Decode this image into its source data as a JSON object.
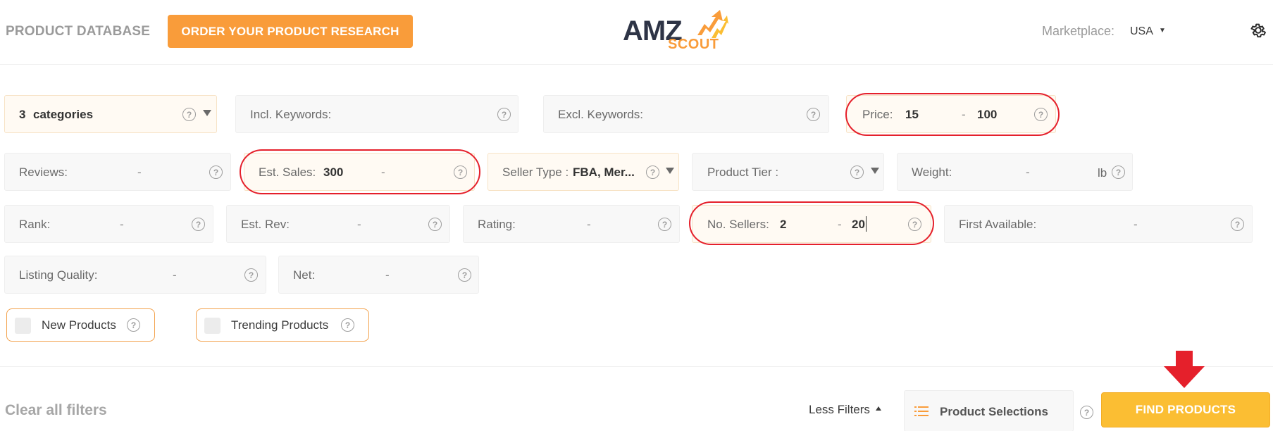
{
  "header": {
    "nav_title": "PRODUCT DATABASE",
    "order_button": "ORDER YOUR PRODUCT RESEARCH",
    "logo_top": "AMZ",
    "logo_bottom": "SCOUT",
    "marketplace_label": "Marketplace:",
    "marketplace_value": "USA"
  },
  "filters": {
    "categories": {
      "value": "3",
      "label": "categories"
    },
    "incl_keywords": {
      "label": "Incl. Keywords:"
    },
    "excl_keywords": {
      "label": "Excl. Keywords:"
    },
    "price": {
      "label": "Price:",
      "min": "15",
      "max": "100"
    },
    "reviews": {
      "label": "Reviews:"
    },
    "est_sales": {
      "label": "Est. Sales:",
      "min": "300"
    },
    "seller_type": {
      "label": "Seller Type :",
      "value": "FBA, Mer..."
    },
    "product_tier": {
      "label": "Product Tier :"
    },
    "weight": {
      "label": "Weight:",
      "unit": "lb"
    },
    "rank": {
      "label": "Rank:"
    },
    "est_rev": {
      "label": "Est. Rev:"
    },
    "rating": {
      "label": "Rating:"
    },
    "no_sellers": {
      "label": "No. Sellers:",
      "min": "2",
      "max": "20"
    },
    "first_available": {
      "label": "First Available:"
    },
    "listing_quality": {
      "label": "Listing Quality:"
    },
    "net": {
      "label": "Net:"
    },
    "dash": "-",
    "help": "?"
  },
  "checkboxes": {
    "new_products": "New Products",
    "trending_products": "Trending Products"
  },
  "footer": {
    "clear_filters": "Clear all filters",
    "less_filters": "Less Filters",
    "product_selections": "Product Selections",
    "find_products": "FIND PRODUCTS"
  },
  "colors": {
    "accent_orange": "#f99c3a",
    "find_button": "#fbbe33",
    "highlight_red": "#e5202b"
  },
  "icons": [
    "settings-gear-icon",
    "help-icon",
    "dropdown-caret-icon",
    "list-filter-icon",
    "red-down-arrow-icon",
    "logo-arrow-icon"
  ]
}
